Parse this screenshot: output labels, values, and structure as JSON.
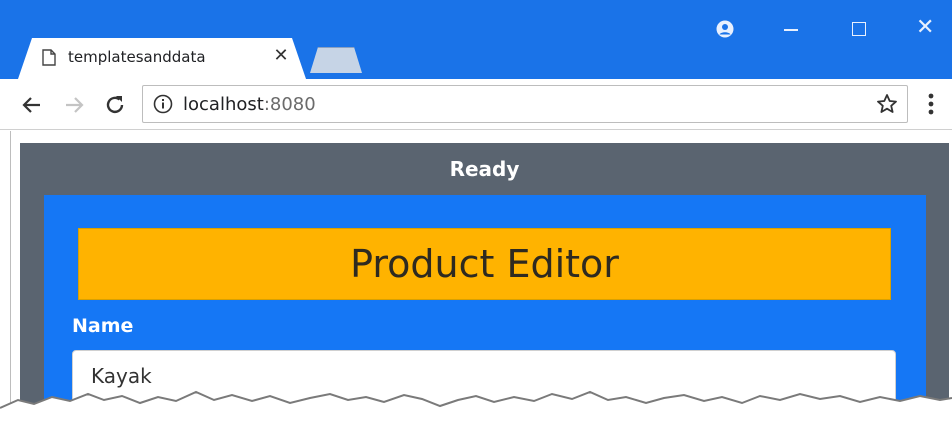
{
  "browser": {
    "tab_title": "templatesanddata",
    "url_host": "localhost",
    "url_port": ":8080",
    "accent_color": "#1a73e8"
  },
  "app": {
    "status": "Ready",
    "editor_title": "Product Editor",
    "name_label": "Name",
    "name_value": "Kayak",
    "colors": {
      "frame": "#5a6470",
      "panel": "#1577f5",
      "header": "#ffb300"
    }
  }
}
